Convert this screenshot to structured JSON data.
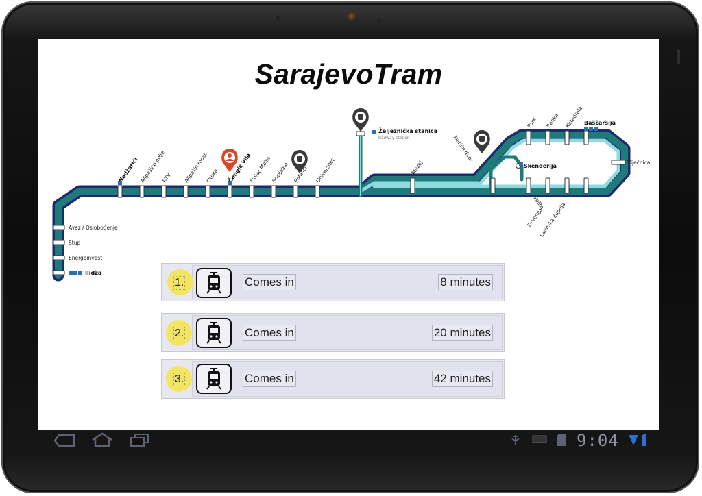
{
  "app": {
    "title": "SarajevoTram"
  },
  "map": {
    "stations_main": [
      "Nedžarići",
      "Alipašino polje",
      "RTV",
      "Alipašin most",
      "Otoka",
      "Čengić Vila",
      "Dolac Malta",
      "Socijalno",
      "Pofalići",
      "Univerzitet"
    ],
    "stations_west": [
      "Avaz / Oslobođenje",
      "Stup",
      "Energoinvest",
      "Ilidža"
    ],
    "station_rail": "Željeznička stanica",
    "station_rail_sub": "Railway station",
    "station_muzej": "Muzej",
    "station_marijin": "Marijin dvor",
    "station_skenderija": "Skenderija",
    "stations_loop_top": [
      "Park",
      "Banka",
      "Katedrala",
      "Baščaršija"
    ],
    "station_vijecnica": "Vijećnica",
    "stations_loop_bottom": [
      "Pošta",
      "Drvenija",
      "Latinska ćuprija"
    ],
    "current_station": "Čengić Vila",
    "colors": {
      "line_outer": "#1f2a6e",
      "line_mid": "#1f7a7a",
      "line_inner": "#8fd9e0",
      "current_pin": "#d54a2a",
      "pin": "#3a3a3a"
    }
  },
  "arrivals": [
    {
      "index": "1.",
      "label": "Comes in",
      "time": "8 minutes",
      "icon": "tram-icon"
    },
    {
      "index": "2.",
      "label": "Comes in",
      "time": "20 minutes",
      "icon": "tram-icon"
    },
    {
      "index": "3.",
      "label": "Comes in",
      "time": "42 minutes",
      "icon": "tram-icon"
    }
  ],
  "status_bar": {
    "clock": "9:04"
  },
  "nav": {
    "back_icon": "back-icon",
    "home_icon": "home-icon",
    "recents_icon": "recent-apps-icon"
  }
}
